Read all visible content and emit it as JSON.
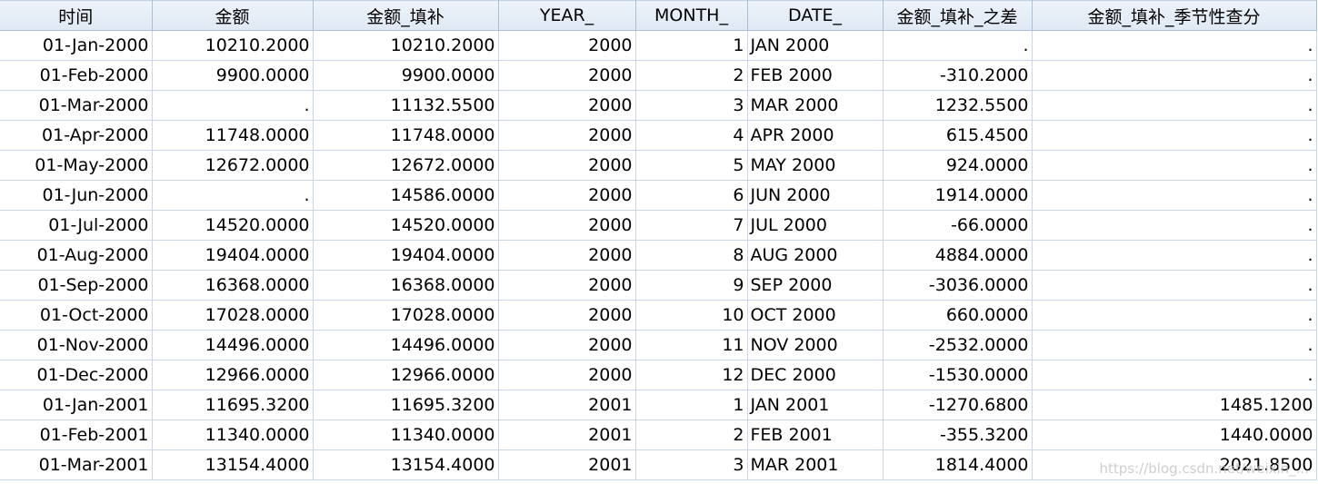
{
  "columns": [
    {
      "label": "时间",
      "align": "num"
    },
    {
      "label": "金额",
      "align": "num"
    },
    {
      "label": "金额_填补",
      "align": "num"
    },
    {
      "label": "YEAR_",
      "align": "num"
    },
    {
      "label": "MONTH_",
      "align": "num"
    },
    {
      "label": "DATE_",
      "align": "txt"
    },
    {
      "label": "金额_填补_之差",
      "align": "num"
    },
    {
      "label": "金额_填补_季节性查分",
      "align": "num"
    }
  ],
  "rows": [
    [
      "01-Jan-2000",
      "10210.2000",
      "10210.2000",
      "2000",
      "1",
      "JAN 2000",
      ".",
      "."
    ],
    [
      "01-Feb-2000",
      "9900.0000",
      "9900.0000",
      "2000",
      "2",
      "FEB 2000",
      "-310.2000",
      "."
    ],
    [
      "01-Mar-2000",
      ".",
      "11132.5500",
      "2000",
      "3",
      "MAR 2000",
      "1232.5500",
      "."
    ],
    [
      "01-Apr-2000",
      "11748.0000",
      "11748.0000",
      "2000",
      "4",
      "APR 2000",
      "615.4500",
      "."
    ],
    [
      "01-May-2000",
      "12672.0000",
      "12672.0000",
      "2000",
      "5",
      "MAY 2000",
      "924.0000",
      "."
    ],
    [
      "01-Jun-2000",
      ".",
      "14586.0000",
      "2000",
      "6",
      "JUN 2000",
      "1914.0000",
      "."
    ],
    [
      "01-Jul-2000",
      "14520.0000",
      "14520.0000",
      "2000",
      "7",
      "JUL 2000",
      "-66.0000",
      "."
    ],
    [
      "01-Aug-2000",
      "19404.0000",
      "19404.0000",
      "2000",
      "8",
      "AUG 2000",
      "4884.0000",
      "."
    ],
    [
      "01-Sep-2000",
      "16368.0000",
      "16368.0000",
      "2000",
      "9",
      "SEP 2000",
      "-3036.0000",
      "."
    ],
    [
      "01-Oct-2000",
      "17028.0000",
      "17028.0000",
      "2000",
      "10",
      "OCT 2000",
      "660.0000",
      "."
    ],
    [
      "01-Nov-2000",
      "14496.0000",
      "14496.0000",
      "2000",
      "11",
      "NOV 2000",
      "-2532.0000",
      "."
    ],
    [
      "01-Dec-2000",
      "12966.0000",
      "12966.0000",
      "2000",
      "12",
      "DEC 2000",
      "-1530.0000",
      "."
    ],
    [
      "01-Jan-2001",
      "11695.3200",
      "11695.3200",
      "2001",
      "1",
      "JAN 2001",
      "-1270.6800",
      "1485.1200"
    ],
    [
      "01-Feb-2001",
      "11340.0000",
      "11340.0000",
      "2001",
      "2",
      "FEB 2001",
      "-355.3200",
      "1440.0000"
    ],
    [
      "01-Mar-2001",
      "13154.4000",
      "13154.4000",
      "2001",
      "3",
      "MAR 2001",
      "1814.4000",
      "2021.8500"
    ]
  ],
  "watermark": "https://blog.csdn.net/weixin_..."
}
